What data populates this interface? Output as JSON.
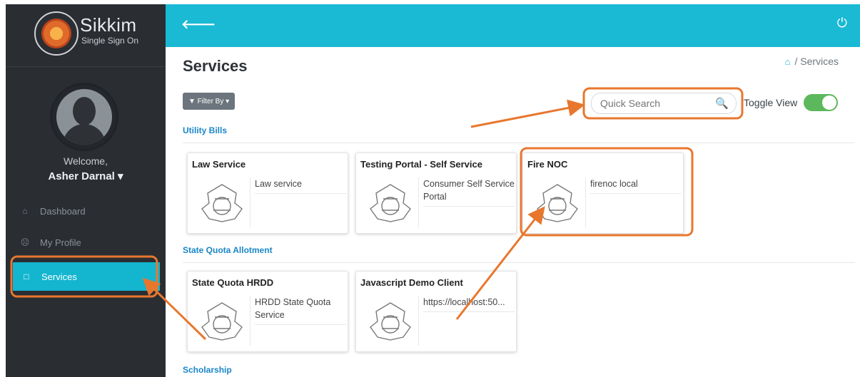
{
  "brand": {
    "name": "Sikkim",
    "subtitle": "Single Sign On"
  },
  "user": {
    "welcome": "Welcome,",
    "name": "Asher Darnal ▾"
  },
  "sidebar": {
    "items": [
      {
        "label": "Dashboard",
        "icon": "home-icon"
      },
      {
        "label": "My Profile",
        "icon": "user-icon"
      },
      {
        "label": "Services",
        "icon": "square-icon",
        "active": true
      }
    ]
  },
  "page": {
    "title": "Services",
    "breadcrumb": "/ Services"
  },
  "toolbar": {
    "filter_label": "▼ Filter By ▾",
    "search_placeholder": "Quick Search",
    "toggle_label": "Toggle View",
    "toggle_on": true
  },
  "sections": [
    {
      "title": "Utility Bills",
      "cards": [
        {
          "title": "Law Service",
          "desc": "Law service"
        },
        {
          "title": "Testing Portal - Self Service",
          "desc": "Consumer Self Service Portal"
        },
        {
          "title": "Fire NOC",
          "desc": "firenoc local"
        }
      ]
    },
    {
      "title": "State Quota Allotment",
      "cards": [
        {
          "title": "State Quota HRDD",
          "desc": "HRDD State Quota Service"
        },
        {
          "title": "Javascript Demo Client",
          "desc": "https://localhost:50..."
        }
      ]
    },
    {
      "title": "Scholarship",
      "cards": []
    }
  ],
  "colors": {
    "accent": "#1ab9d4",
    "sidebar": "#2a2e33",
    "annotation": "#e8772e",
    "section_title": "#1a86c8",
    "toggle": "#5cb85c"
  }
}
